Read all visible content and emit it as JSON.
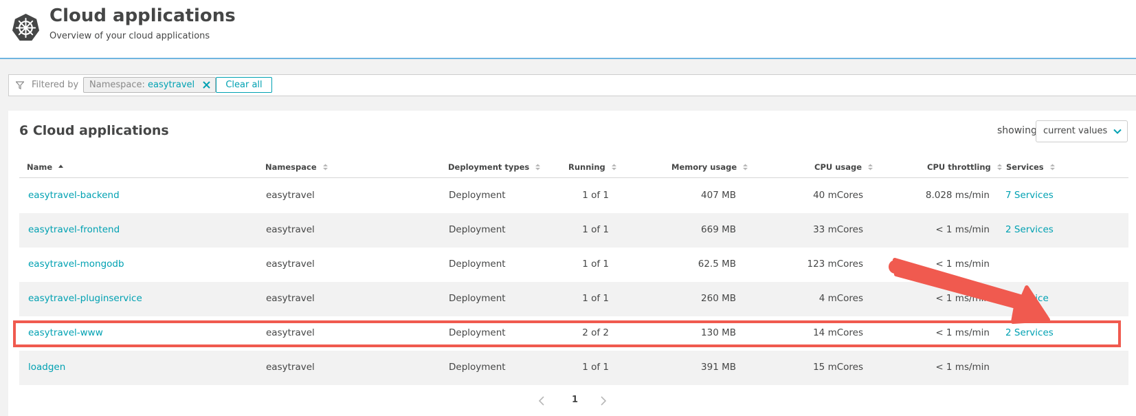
{
  "header": {
    "title": "Cloud applications",
    "subtitle": "Overview of your cloud applications",
    "logo_icon": "kubernetes-helm-icon"
  },
  "filter": {
    "label": "Filtered by",
    "chip_key": "Namespace:",
    "chip_value": "easytravel",
    "clear_label": "Clear all"
  },
  "card": {
    "count_title": "6 Cloud applications",
    "showing_label": "showing",
    "showing_value": "current values"
  },
  "columns": [
    "Name",
    "Namespace",
    "Deployment types",
    "Running",
    "Memory usage",
    "CPU usage",
    "CPU throttling",
    "Services"
  ],
  "rows": [
    {
      "name": "easytravel-backend",
      "namespace": "easytravel",
      "type": "Deployment",
      "running": "1 of 1",
      "memory": "407 MB",
      "cpu": "40 mCores",
      "throttling": "8.028 ms/min",
      "services": "7 Services"
    },
    {
      "name": "easytravel-frontend",
      "namespace": "easytravel",
      "type": "Deployment",
      "running": "1 of 1",
      "memory": "669 MB",
      "cpu": "33 mCores",
      "throttling": "< 1 ms/min",
      "services": "2 Services"
    },
    {
      "name": "easytravel-mongodb",
      "namespace": "easytravel",
      "type": "Deployment",
      "running": "1 of 1",
      "memory": "62.5 MB",
      "cpu": "123 mCores",
      "throttling": "< 1 ms/min",
      "services": ""
    },
    {
      "name": "easytravel-pluginservice",
      "namespace": "easytravel",
      "type": "Deployment",
      "running": "1 of 1",
      "memory": "260 MB",
      "cpu": "4 mCores",
      "throttling": "< 1 ms/min",
      "services": "1 Service"
    },
    {
      "name": "easytravel-www",
      "namespace": "easytravel",
      "type": "Deployment",
      "running": "2 of 2",
      "memory": "130 MB",
      "cpu": "14 mCores",
      "throttling": "< 1 ms/min",
      "services": "2 Services"
    },
    {
      "name": "loadgen",
      "namespace": "easytravel",
      "type": "Deployment",
      "running": "1 of 1",
      "memory": "391 MB",
      "cpu": "15 mCores",
      "throttling": "< 1 ms/min",
      "services": ""
    }
  ],
  "pagination": {
    "current_page": "1"
  },
  "annotation": {
    "color": "#f05a4f",
    "highlighted_row": "easytravel-www"
  },
  "colors": {
    "accent": "#00a1b2",
    "text": "#454646",
    "muted": "#898989"
  }
}
